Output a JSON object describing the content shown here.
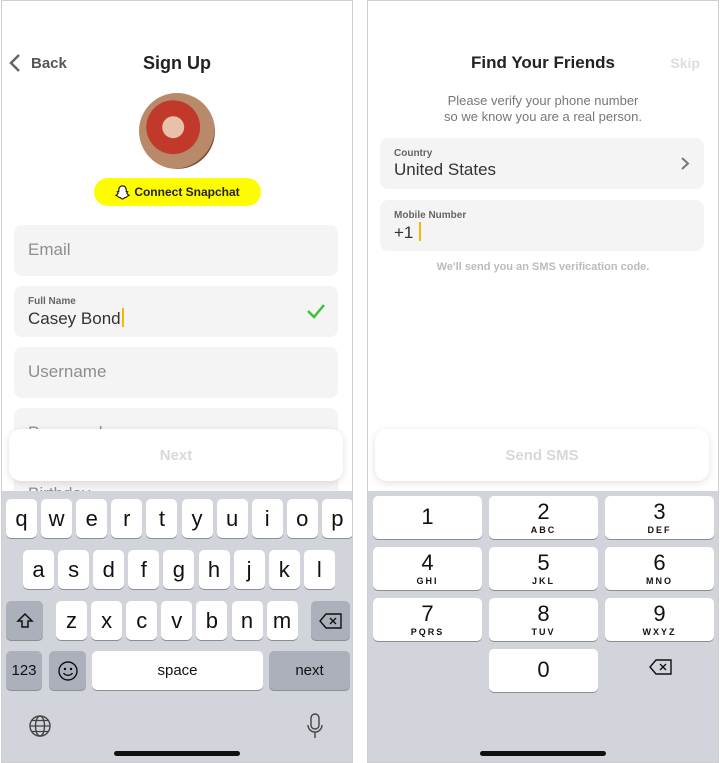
{
  "signup": {
    "back_label": "Back",
    "title": "Sign Up",
    "connect_label": "Connect Snapchat",
    "email_placeholder": "Email",
    "fullname_label": "Full Name",
    "fullname_value": "Casey Bond",
    "username_placeholder": "Username",
    "password_placeholder": "Password",
    "birthday_placeholder": "Birthday",
    "next_label": "Next",
    "accent": "#fffc00",
    "check_color": "#3cc13b"
  },
  "keyboard": {
    "row1": [
      "q",
      "w",
      "e",
      "r",
      "t",
      "y",
      "u",
      "i",
      "o",
      "p"
    ],
    "row2": [
      "a",
      "s",
      "d",
      "f",
      "g",
      "h",
      "j",
      "k",
      "l"
    ],
    "row3": [
      "z",
      "x",
      "c",
      "v",
      "b",
      "n",
      "m"
    ],
    "numbers_label": "123",
    "space_label": "space",
    "return_label": "next"
  },
  "friends": {
    "title": "Find Your Friends",
    "skip_label": "Skip",
    "subtitle_line1": "Please verify your phone number",
    "subtitle_line2": "so we know you are a real person.",
    "country_label": "Country",
    "country_value": "United States",
    "mobile_label": "Mobile Number",
    "mobile_value": "+1",
    "sms_note": "We'll send you an SMS verification code.",
    "send_label": "Send SMS"
  },
  "numpad": [
    {
      "d": "1",
      "s": ""
    },
    {
      "d": "2",
      "s": "ABC"
    },
    {
      "d": "3",
      "s": "DEF"
    },
    {
      "d": "4",
      "s": "GHI"
    },
    {
      "d": "5",
      "s": "JKL"
    },
    {
      "d": "6",
      "s": "MNO"
    },
    {
      "d": "7",
      "s": "PQRS"
    },
    {
      "d": "8",
      "s": "TUV"
    },
    {
      "d": "9",
      "s": "WXYZ"
    },
    {
      "d": "0",
      "s": ""
    }
  ]
}
